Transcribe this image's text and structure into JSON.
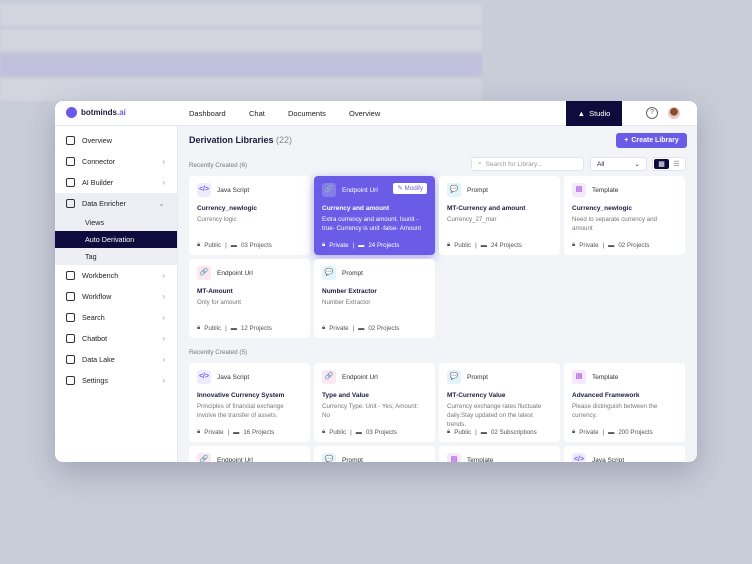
{
  "app": {
    "brand": "botminds",
    "brand_suffix": ".ai",
    "nav": [
      "Dashboard",
      "Chat",
      "Documents",
      "Overview"
    ],
    "studio": "Studio",
    "help": "?"
  },
  "sidebar": {
    "items": [
      {
        "label": "Overview",
        "chev": ""
      },
      {
        "label": "Connector",
        "chev": "›"
      },
      {
        "label": "AI Builder",
        "chev": "›"
      },
      {
        "label": "Data Enricher",
        "chev": "⌄"
      }
    ],
    "sub": [
      "Views",
      "Auto Derivation",
      "Tag"
    ],
    "items2": [
      {
        "label": "Workbench"
      },
      {
        "label": "Workflow"
      },
      {
        "label": "Search"
      },
      {
        "label": "Chatbot"
      },
      {
        "label": "Data Lake"
      },
      {
        "label": "Settings"
      }
    ],
    "chev": "›"
  },
  "main": {
    "title": "Derivation Libraries",
    "count": "(22)",
    "create": "Create Library",
    "create_icon": "+",
    "search_placeholder": "Search for Library...",
    "filter": "All",
    "filter_icon": "⌄",
    "grid_icon": "▦",
    "list_icon": "☰",
    "modify": "✎ Modify",
    "section1": "Recently Created (6)",
    "section2": "Recently Created (5)"
  },
  "cards1": [
    {
      "type": "Java Script",
      "icon": "</>",
      "color": "#6b5ce7",
      "bg": "#eeebfd",
      "name": "Currency_newlogic",
      "desc": "Currency logic",
      "access": "Public",
      "projects": "03 Projects"
    },
    {
      "type": "Endpoint Url",
      "icon": "🔗",
      "color": "#e83e8c",
      "bg": "#fde7f1",
      "name": "Currency and amount",
      "desc": "Extra currency and amount. Isunit - true- Currency is unit -false- Amount",
      "access": "Private",
      "projects": "24 Projects",
      "highlight": true
    },
    {
      "type": "Prompt",
      "icon": "💬",
      "color": "#1ea4dc",
      "bg": "#e2f4fb",
      "name": "MT-Currency and amount",
      "desc": "Currency_27_mar",
      "access": "Public",
      "projects": "24 Projects"
    },
    {
      "type": "Template",
      "icon": "▤",
      "color": "#b15ee0",
      "bg": "#f4e8fb",
      "name": "Currency_newlogic",
      "desc": "Need to separate currency and amount",
      "access": "Private",
      "projects": "02 Projects"
    },
    {
      "type": "Endpoint Url",
      "icon": "🔗",
      "color": "#e83e8c",
      "bg": "#fde7f1",
      "name": "MT-Amount",
      "desc": "Only for amount",
      "access": "Public",
      "projects": "12 Projects"
    },
    {
      "type": "Prompt",
      "icon": "💬",
      "color": "#1ea4dc",
      "bg": "#e2f4fb",
      "name": "Number Extractor",
      "desc": "Number Extractor",
      "access": "Private",
      "projects": "02 Projects"
    }
  ],
  "cards2": [
    {
      "type": "Java Script",
      "icon": "</>",
      "color": "#6b5ce7",
      "bg": "#eeebfd",
      "name": "Innovative Currency System",
      "desc": "Principles of financial exchange involve the transfer of assets.",
      "access": "Private",
      "projects": "16 Projects"
    },
    {
      "type": "Endpoint Url",
      "icon": "🔗",
      "color": "#e83e8c",
      "bg": "#fde7f1",
      "name": "Type and Value",
      "desc": "Currency Type: Unit - Yes; Amount: No",
      "access": "Public",
      "projects": "03 Projects"
    },
    {
      "type": "Prompt",
      "icon": "💬",
      "color": "#1ea4dc",
      "bg": "#e2f4fb",
      "name": "MT-Currency Value",
      "desc": "Currency exchange rates fluctuate daily.Stay updated on the latest trends.",
      "access": "Public",
      "projects": "02 Subscriptions"
    },
    {
      "type": "Template",
      "icon": "▤",
      "color": "#b15ee0",
      "bg": "#f4e8fb",
      "name": "Advanced Framework",
      "desc": "Please distinguish between the currency.",
      "access": "Private",
      "projects": "200 Projects"
    },
    {
      "type": "Endpoint Url",
      "icon": "🔗",
      "color": "#e83e8c",
      "bg": "#fde7f1"
    },
    {
      "type": "Prompt",
      "icon": "💬",
      "color": "#1ea4dc",
      "bg": "#e2f4fb"
    },
    {
      "type": "Template",
      "icon": "▤",
      "color": "#b15ee0",
      "bg": "#f4e8fb"
    },
    {
      "type": "Java Script",
      "icon": "</>",
      "color": "#6b5ce7",
      "bg": "#eeebfd"
    }
  ]
}
